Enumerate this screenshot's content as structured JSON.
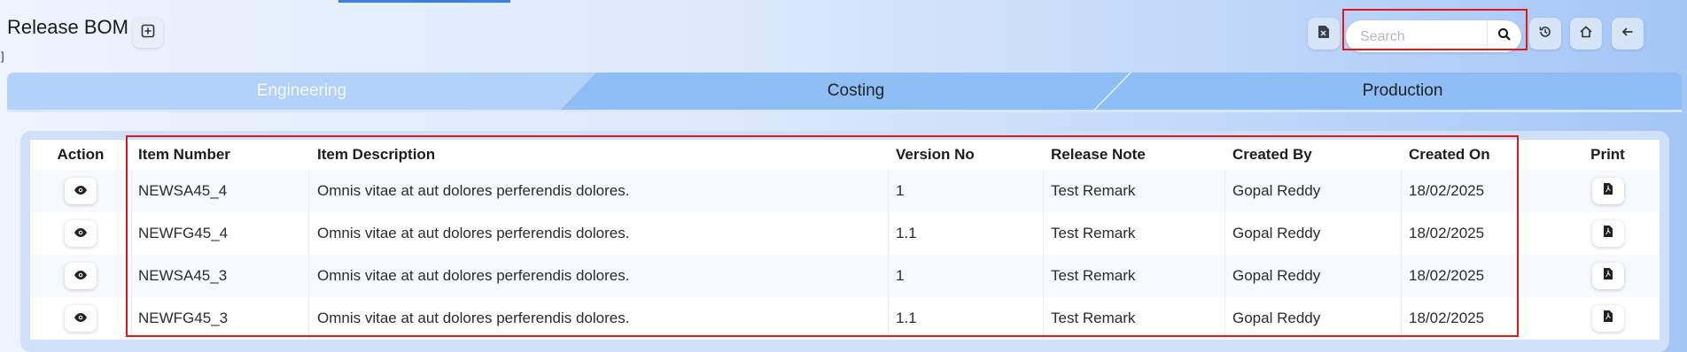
{
  "header": {
    "title": "Release BOM",
    "search_placeholder": "Search",
    "search_value": ""
  },
  "tabs": [
    {
      "label": "Engineering",
      "active": true
    },
    {
      "label": "Costing",
      "active": false
    },
    {
      "label": "Production",
      "active": false
    }
  ],
  "stray_text": "]",
  "table": {
    "columns": [
      "Action",
      "Item Number",
      "Item Description",
      "Version No",
      "Release Note",
      "Created By",
      "Created On",
      "Print"
    ],
    "rows": [
      {
        "item_number": "NEWSA45_4",
        "item_description": "Omnis vitae at aut dolores perferendis dolores.",
        "version_no": "1",
        "release_note": "Test Remark",
        "created_by": "Gopal Reddy",
        "created_on": "18/02/2025"
      },
      {
        "item_number": "NEWFG45_4",
        "item_description": "Omnis vitae at aut dolores perferendis dolores.",
        "version_no": "1.1",
        "release_note": "Test Remark",
        "created_by": "Gopal Reddy",
        "created_on": "18/02/2025"
      },
      {
        "item_number": "NEWSA45_3",
        "item_description": "Omnis vitae at aut dolores perferendis dolores.",
        "version_no": "1",
        "release_note": "Test Remark",
        "created_by": "Gopal Reddy",
        "created_on": "18/02/2025"
      },
      {
        "item_number": "NEWFG45_3",
        "item_description": "Omnis vitae at aut dolores perferendis dolores.",
        "version_no": "1.1",
        "release_note": "Test Remark",
        "created_by": "Gopal Reddy",
        "created_on": "18/02/2025"
      }
    ]
  },
  "icons": {
    "add": "plus-square-icon",
    "excel": "excel-file-icon",
    "search": "search-icon",
    "history": "history-icon",
    "home": "home-icon",
    "back": "arrow-left-icon",
    "view": "eye-icon",
    "print": "pdf-icon"
  },
  "colors": {
    "highlight": "#e1171e",
    "tab_bar": "#8fbdf6",
    "tab_active": "#b3d2fa"
  }
}
